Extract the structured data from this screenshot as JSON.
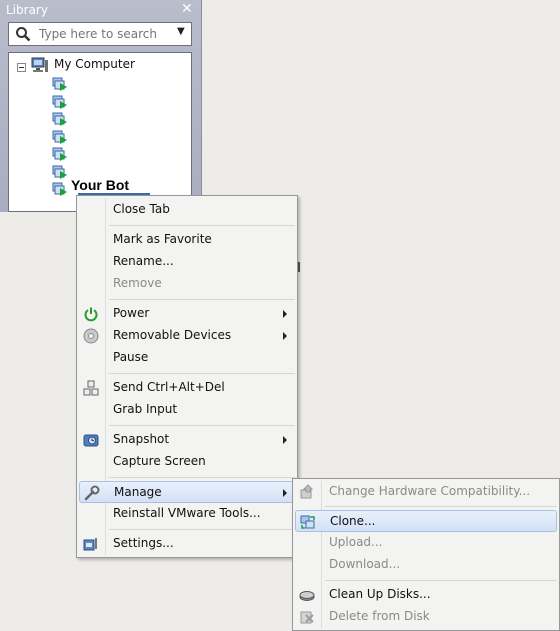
{
  "library": {
    "title": "Library",
    "close": "✕",
    "search_placeholder": "Type here to search",
    "tree": {
      "root": "My Computer",
      "selected_vm": "Your Bot"
    }
  },
  "context_menu": {
    "close_tab": "Close Tab",
    "mark_favorite": "Mark as Favorite",
    "rename": "Rename...",
    "remove": "Remove",
    "power": "Power",
    "removable_devices": "Removable Devices",
    "pause": "Pause",
    "send_cad": "Send Ctrl+Alt+Del",
    "grab_input": "Grab Input",
    "snapshot": "Snapshot",
    "capture_screen": "Capture Screen",
    "manage": "Manage",
    "reinstall_tools": "Reinstall VMware Tools...",
    "settings": "Settings..."
  },
  "manage_submenu": {
    "change_hw": "Change Hardware Compatibility...",
    "clone": "Clone...",
    "upload": "Upload...",
    "download": "Download...",
    "cleanup": "Clean Up Disks...",
    "delete": "Delete from Disk"
  },
  "colors": {
    "highlight": "#d3e1f6",
    "power_green": "#2e9b2e",
    "library_bg": "#b0b4c6"
  }
}
